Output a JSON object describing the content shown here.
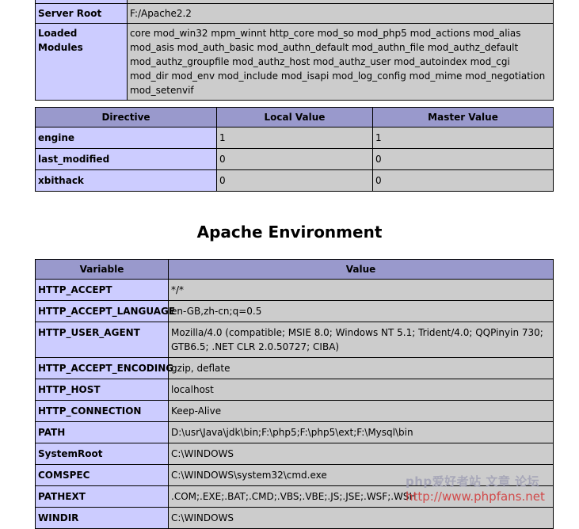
{
  "core_table": {
    "rows": [
      {
        "name": "",
        "value": ""
      },
      {
        "name": "Server Root",
        "value": "F:/Apache2.2"
      },
      {
        "name": "Loaded Modules",
        "value": "core mod_win32 mpm_winnt http_core mod_so mod_php5 mod_actions mod_alias mod_asis mod_auth_basic mod_authn_default mod_authn_file mod_authz_default mod_authz_groupfile mod_authz_host mod_authz_user mod_autoindex mod_cgi mod_dir mod_env mod_include mod_isapi mod_log_config mod_mime mod_negotiation mod_setenvif"
      }
    ]
  },
  "directive_table": {
    "headers": [
      "Directive",
      "Local Value",
      "Master Value"
    ],
    "rows": [
      {
        "directive": "engine",
        "local": "1",
        "master": "1"
      },
      {
        "directive": "last_modified",
        "local": "0",
        "master": "0"
      },
      {
        "directive": "xbithack",
        "local": "0",
        "master": "0"
      }
    ]
  },
  "section_title": "Apache Environment",
  "env_table": {
    "headers": [
      "Variable",
      "Value"
    ],
    "rows": [
      {
        "variable": "HTTP_ACCEPT",
        "value": "*/*"
      },
      {
        "variable": "HTTP_ACCEPT_LANGUAGE",
        "value": "en-GB,zh-cn;q=0.5"
      },
      {
        "variable": "HTTP_USER_AGENT",
        "value": "Mozilla/4.0 (compatible; MSIE 8.0; Windows NT 5.1; Trident/4.0; QQPinyin 730; GTB6.5; .NET CLR 2.0.50727; CIBA)"
      },
      {
        "variable": "HTTP_ACCEPT_ENCODING",
        "value": "gzip, deflate"
      },
      {
        "variable": "HTTP_HOST",
        "value": "localhost"
      },
      {
        "variable": "HTTP_CONNECTION",
        "value": "Keep-Alive"
      },
      {
        "variable": "PATH",
        "value": "D:\\usr\\Java\\jdk\\bin;F:\\php5;F:\\php5\\ext;F:\\Mysql\\bin"
      },
      {
        "variable": "SystemRoot",
        "value": "C:\\WINDOWS"
      },
      {
        "variable": "COMSPEC",
        "value": "C:\\WINDOWS\\system32\\cmd.exe"
      },
      {
        "variable": "PATHEXT",
        "value": ".COM;.EXE;.BAT;.CMD;.VBS;.VBE;.JS;.JSE;.WSF;.WSH"
      },
      {
        "variable": "WINDIR",
        "value": "C:\\WINDOWS"
      }
    ]
  },
  "watermark": {
    "line1": "php爱好者站 文章 论坛",
    "line2": "http://www.phpfans.net"
  },
  "colors": {
    "header_bg": "#9999cc",
    "label_bg": "#ccccff",
    "value_bg": "#cccccc",
    "watermark_url": "#d23c3c"
  }
}
